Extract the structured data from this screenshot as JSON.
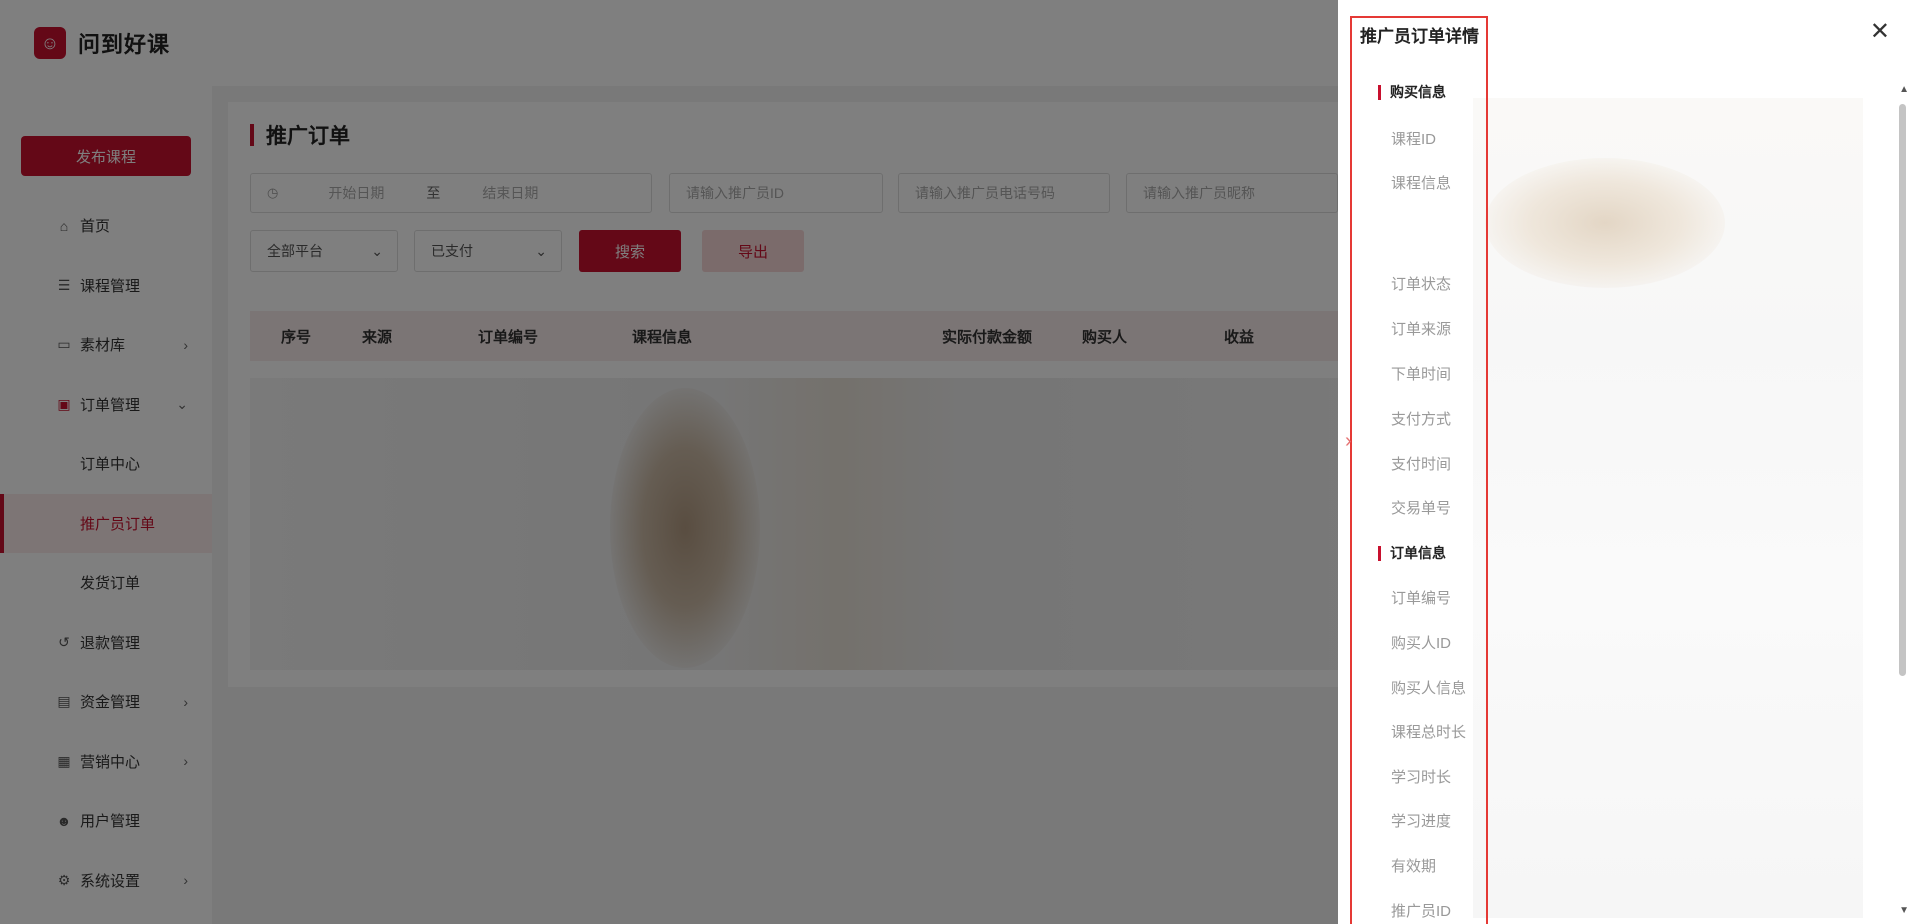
{
  "app": {
    "name": "问到好课"
  },
  "sidebar": {
    "publish_label": "发布课程",
    "items": [
      {
        "label": "首页"
      },
      {
        "label": "课程管理"
      },
      {
        "label": "素材库"
      },
      {
        "label": "订单管理"
      },
      {
        "label": "订单中心"
      },
      {
        "label": "推广员订单"
      },
      {
        "label": "发货订单"
      },
      {
        "label": "退款管理"
      },
      {
        "label": "资金管理"
      },
      {
        "label": "营销中心"
      },
      {
        "label": "用户管理"
      },
      {
        "label": "系统设置"
      }
    ],
    "active": "推广员订单"
  },
  "main": {
    "title": "推广订单",
    "filters": {
      "start_date_placeholder": "开始日期",
      "range_separator": "至",
      "end_date_placeholder": "结束日期",
      "promoter_id_placeholder": "请输入推广员ID",
      "promoter_phone_placeholder": "请输入推广员电话号码",
      "promoter_nickname_placeholder": "请输入推广员昵称",
      "platform_value": "全部平台",
      "status_value": "已支付",
      "search_label": "搜索",
      "export_label": "导出"
    },
    "table": {
      "columns": [
        "序号",
        "来源",
        "订单编号",
        "课程信息",
        "实际付款金额",
        "购买人",
        "收益"
      ]
    }
  },
  "drawer": {
    "title": "推广员订单详情",
    "sections": {
      "purchase": "购买信息",
      "order": "订单信息"
    },
    "purchase_fields": [
      "课程ID",
      "课程信息",
      "订单状态",
      "订单来源",
      "下单时间",
      "支付方式",
      "支付时间",
      "交易单号"
    ],
    "order_fields": [
      "订单编号",
      "购买人ID",
      "购买人信息",
      "课程总时长",
      "学习时长",
      "学习进度",
      "有效期",
      "推广员ID"
    ]
  },
  "colors": {
    "accent": "#c8102e",
    "highlight_border": "#e53935"
  }
}
